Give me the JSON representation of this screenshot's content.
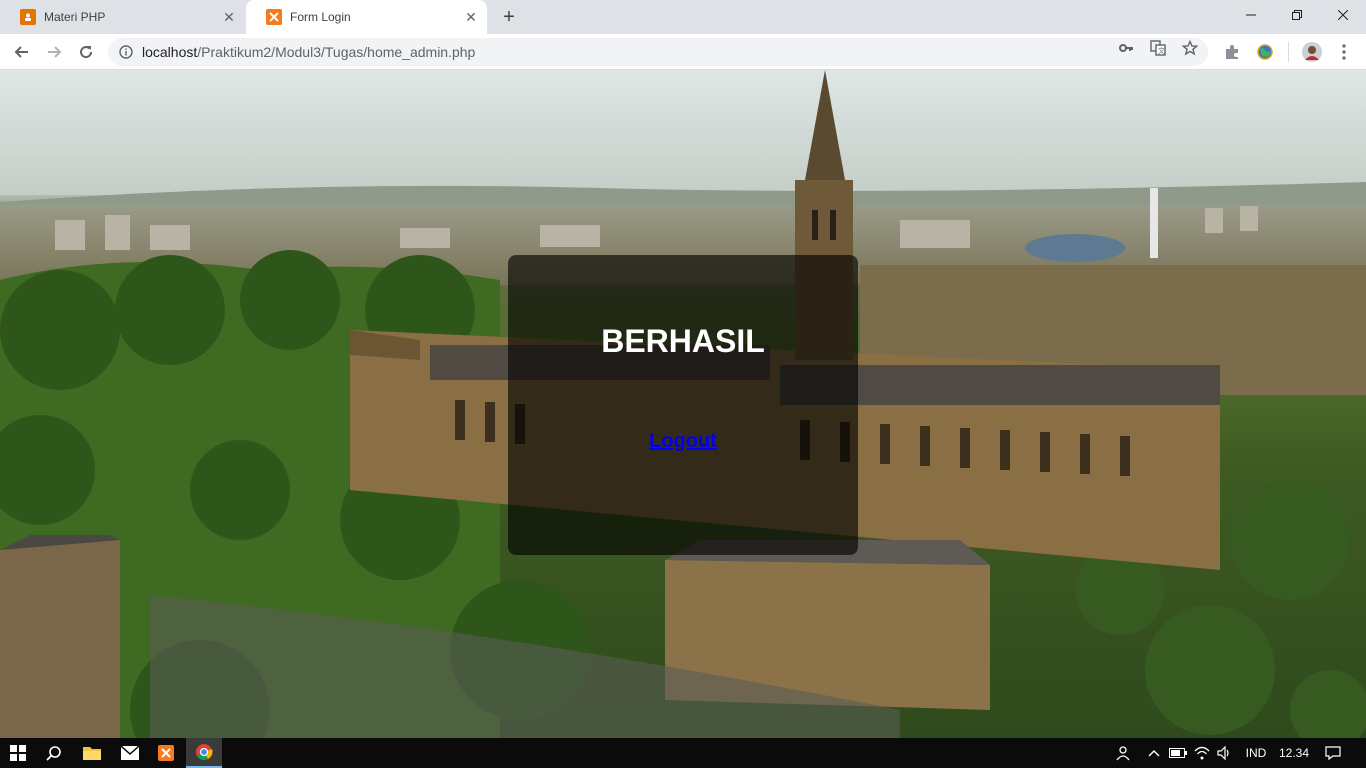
{
  "browser": {
    "tabs": [
      {
        "title": "Materi PHP",
        "active": false
      },
      {
        "title": "Form Login",
        "active": true
      }
    ],
    "address": {
      "host": "localhost",
      "path": "/Praktikum2/Modul3/Tugas/home_admin.php"
    },
    "icons": [
      "back-icon",
      "forward-icon",
      "reload-icon",
      "info-icon",
      "key-icon",
      "translate-icon",
      "star-icon",
      "extension-icon",
      "globe-icon",
      "profile-avatar",
      "menu-icon"
    ]
  },
  "page": {
    "title": "BERHASIL",
    "logout_label": "Logout"
  },
  "taskbar": {
    "language": "IND",
    "time": "12.34"
  },
  "colors": {
    "panel": "#000000",
    "link": "#0000ee",
    "taskbar": "#0b0b0b"
  }
}
